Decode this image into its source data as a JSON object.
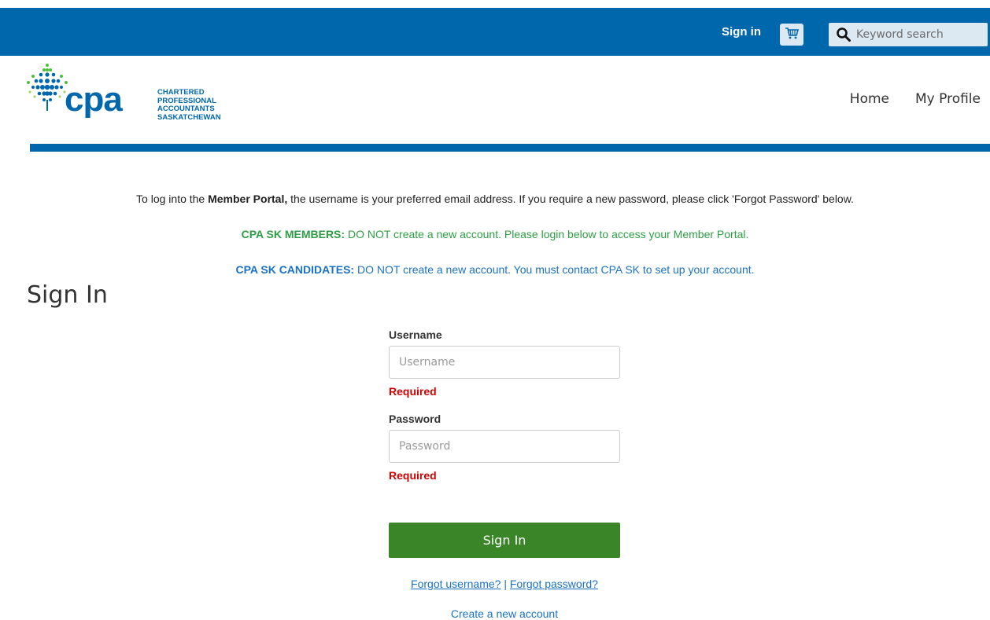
{
  "topbar": {
    "signin_label": "Sign in",
    "cart_icon": "shopping-cart-icon",
    "search_icon": "magnifier-icon",
    "search_placeholder": "Keyword search"
  },
  "logo": {
    "wordmark": "cpa",
    "lines": [
      "CHARTERED",
      "PROFESSIONAL",
      "ACCOUNTANTS",
      "SASKATCHEWAN"
    ]
  },
  "nav": {
    "items": [
      {
        "label": "Home"
      },
      {
        "label": "My Profile"
      }
    ]
  },
  "info": {
    "line1": {
      "pre": "To log into the ",
      "bold": "Member Portal,",
      "post": " the username is your preferred email address.  If you require a new password, please click 'Forgot Password' below."
    },
    "line2": {
      "bold": "CPA SK MEMBERS:",
      "post": " DO NOT create a new account.  Please login below to access your Member Portal."
    },
    "line3": {
      "bold": "CPA SK CANDIDATES:",
      "post": " DO NOT create a new account.  You must contact CPA SK to set up your account."
    }
  },
  "page_title": "Sign In",
  "form": {
    "username": {
      "label": "Username",
      "placeholder": "Username",
      "value": "",
      "error": "Required"
    },
    "password": {
      "label": "Password",
      "placeholder": "Password",
      "value": "",
      "error": "Required"
    },
    "submit_label": "Sign In",
    "forgot_username": "Forgot username?",
    "separator": " | ",
    "forgot_password": "Forgot password?",
    "create_account": "Create a new account"
  },
  "colors": {
    "brand_blue": "#0067ac",
    "members_green": "#2e9e44",
    "candidates_blue": "#1a72c4",
    "button_green": "#3a8527",
    "error_red": "#d40000"
  }
}
